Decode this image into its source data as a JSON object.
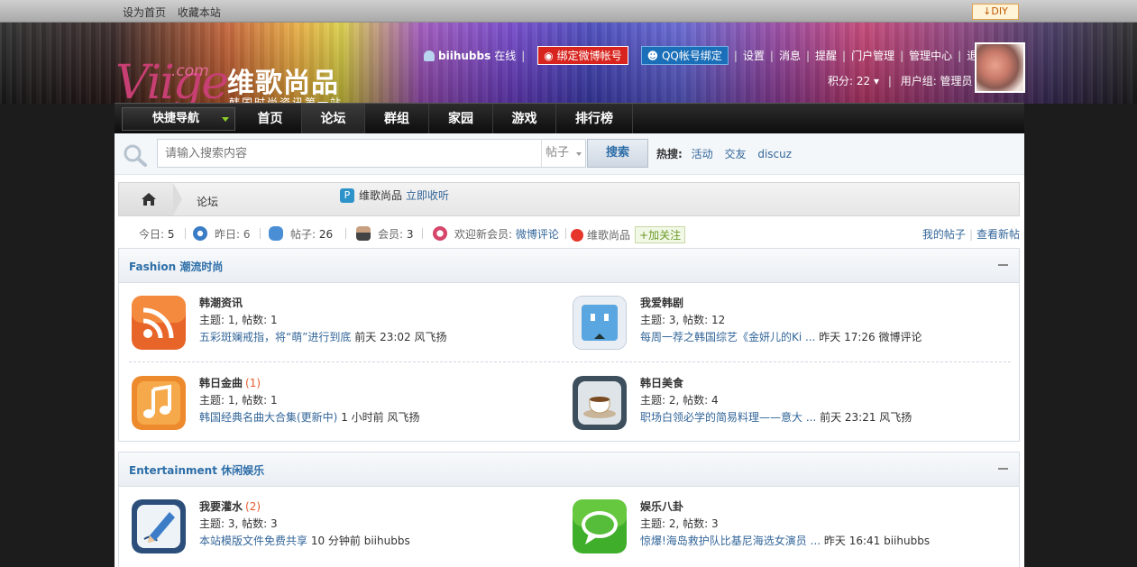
{
  "topbar": {
    "set_home": "设为首页",
    "bookmark": "收藏本站",
    "diy": "DIY"
  },
  "header": {
    "logo_latin": "Viige",
    "logo_com": ".com",
    "logo_cn": "维歌尚品",
    "logo_sub": "韩国时尚资讯第一站",
    "username": "biihubbs",
    "online": "在线",
    "weibo_bind": "绑定微博帐号",
    "qq_bind": "QQ帐号绑定",
    "links": [
      "设置",
      "消息",
      "提醒",
      "门户管理",
      "管理中心",
      "退出"
    ],
    "points": "积分: 22",
    "usergroup": "用户组: 管理员"
  },
  "nav": {
    "quick": "快捷导航",
    "items": [
      "首页",
      "论坛",
      "群组",
      "家园",
      "游戏",
      "排行榜"
    ],
    "active": "论坛"
  },
  "search": {
    "placeholder": "请输入搜索内容",
    "type": "帖子",
    "button": "搜索",
    "hot_label": "热搜:",
    "hot": [
      "活动",
      "交友",
      "discuz"
    ]
  },
  "breadcrumb": {
    "forum": "论坛",
    "site": "维歌尚品",
    "collect": "立即收听"
  },
  "stats": {
    "today_label": "今日:",
    "today": "5",
    "yesterday_label": "昨日:",
    "yesterday": "6",
    "posts_label": "帖子:",
    "posts": "26",
    "members_label": "会员:",
    "members": "3",
    "welcome_label": "欢迎新会员:",
    "welcome_user": "微博评论",
    "weibo_name": "维歌尚品",
    "follow": "+加关注",
    "my_posts": "我的帖子",
    "new_posts": "查看新帖"
  },
  "categories": [
    {
      "title": "Fashion 潮流时尚",
      "forums": [
        {
          "name": "韩潮资讯",
          "new": "",
          "stats": "主题: 1, 帖数: 1",
          "last_title": "五彩斑斓戒指，将“萌”进行到底",
          "last_meta": " 前天 23:02 风飞扬",
          "icon": "rss-icon"
        },
        {
          "name": "我爱韩剧",
          "new": "",
          "stats": "主题: 3, 帖数: 12",
          "last_title": "每周一荐之韩国综艺《金妍儿的Ki ...",
          "last_meta": " 昨天 17:26 微博评论",
          "icon": "tv-icon"
        },
        {
          "name": "韩日金曲",
          "new": "(1)",
          "stats": "主题: 1, 帖数: 1",
          "last_title": "韩国经典名曲大合集(更新中)",
          "last_meta": " 1 小时前 风飞扬",
          "icon": "music-icon"
        },
        {
          "name": "韩日美食",
          "new": "",
          "stats": "主题: 2, 帖数: 4",
          "last_title": "职场白领必学的简易料理——意大 ...",
          "last_meta": " 前天 23:21 风飞扬",
          "icon": "coffee-icon"
        }
      ]
    },
    {
      "title": "Entertainment 休闲娱乐",
      "forums": [
        {
          "name": "我要灌水",
          "new": "(2)",
          "stats": "主题: 3, 帖数: 3",
          "last_title": "本站模版文件免费共享",
          "last_meta": " 10 分钟前 biihubbs",
          "icon": "pencil-icon"
        },
        {
          "name": "娱乐八卦",
          "new": "",
          "stats": "主题: 2, 帖数: 3",
          "last_title": "惊爆!海岛救护队比基尼海选女演员 ...",
          "last_meta": " 昨天 16:41 biihubbs",
          "icon": "chat-bubble-icon"
        }
      ]
    }
  ]
}
